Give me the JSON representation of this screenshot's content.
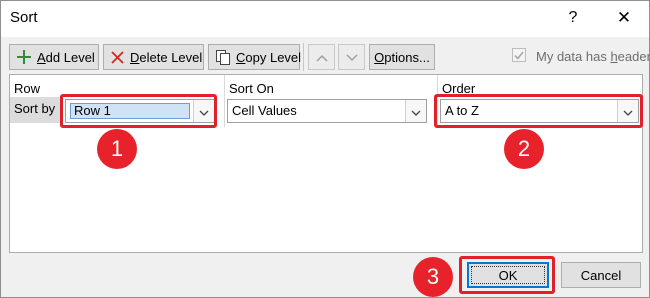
{
  "window": {
    "title": "Sort",
    "help_label": "?",
    "close_label": "✕"
  },
  "toolbar": {
    "add_level": {
      "acc": "A",
      "rest": "dd Level",
      "icon": "plus-icon"
    },
    "delete_level": {
      "acc": "D",
      "rest": "elete Level",
      "icon": "delete-x-icon"
    },
    "copy_level": {
      "acc": "C",
      "rest": "opy Level",
      "icon": "copy-icon"
    },
    "move_up_icon": "chevron-up-icon",
    "move_down_icon": "chevron-down-icon",
    "options": {
      "acc": "O",
      "rest": "ptions..."
    },
    "headers_checkbox": {
      "checked": true,
      "pre": "My data has ",
      "acc": "h",
      "post": "eaders"
    }
  },
  "grid": {
    "columns": {
      "row": "Row",
      "sort_on": "Sort On",
      "order": "Order"
    },
    "row_label": "Sort by",
    "row_value": "Row 1",
    "sort_on_value": "Cell Values",
    "order_value": "A to Z"
  },
  "annotations": {
    "badge1": "1",
    "badge2": "2",
    "badge3": "3",
    "highlight_color": "#e0202a"
  },
  "footer": {
    "ok_label": "OK",
    "cancel_label": "Cancel"
  }
}
